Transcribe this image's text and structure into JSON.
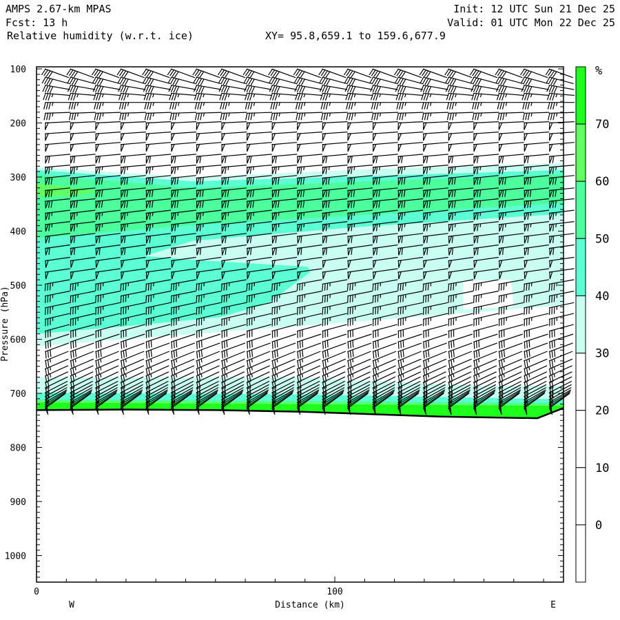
{
  "header": {
    "model": "AMPS 2.67-km MPAS",
    "fcst": "Fcst:   13 h",
    "field": "Relative humidity (w.r.t. ice)",
    "xy": "XY=  95.8,659.1 to 159.6,677.9",
    "init": "Init: 12 UTC Sun 21 Dec 25",
    "valid": "Valid: 01 UTC Mon 22 Dec 25"
  },
  "chart_data": {
    "type": "cross-section",
    "title": "Relative humidity (w.r.t. ice)",
    "xlabel": "Distance (km)",
    "ylabel": "Pressure (hPa)",
    "xlim": [
      0,
      176.7
    ],
    "ylim": [
      1049,
      97
    ],
    "x_ticks": [
      "0",
      "100"
    ],
    "x_tick_values": [
      0,
      100
    ],
    "y_ticks": [
      "100",
      "200",
      "300",
      "400",
      "500",
      "600",
      "700",
      "800",
      "900",
      "1000"
    ],
    "y_tick_values": [
      100,
      200,
      300,
      400,
      500,
      600,
      700,
      800,
      900,
      1000
    ],
    "left_end": "W",
    "right_end": "E",
    "colorbar": {
      "unit": "%",
      "labels": [
        "70",
        "60",
        "50",
        "40",
        "30",
        "20",
        "10",
        "0"
      ],
      "bins": [
        {
          "range": ">70",
          "color": "#1eff1e"
        },
        {
          "range": "60-70",
          "color": "#62ff62"
        },
        {
          "range": "50-60",
          "color": "#4dff9c"
        },
        {
          "range": "40-50",
          "color": "#5cffd4"
        },
        {
          "range": "30-40",
          "color": "#c8fff0"
        },
        {
          "range": "20-30",
          "color": "#ffffff"
        },
        {
          "range": "10-20",
          "color": "#ffffff"
        },
        {
          "range": "0-10",
          "color": "#ffffff"
        },
        {
          "range": "<0",
          "color": "#ffffff"
        }
      ]
    },
    "ground": [
      [
        0,
        731
      ],
      [
        30,
        730
      ],
      [
        60,
        731
      ],
      [
        89.4,
        734
      ],
      [
        135.6,
        743
      ],
      [
        167.9,
        746
      ],
      [
        176.7,
        727
      ]
    ],
    "fills": [
      {
        "range": "30-40",
        "color": "#c8fff0",
        "polygon": [
          [
            0,
            282
          ],
          [
            52.4,
            300
          ],
          [
            114.1,
            285
          ],
          [
            176.7,
            274
          ],
          [
            176.7,
            537
          ],
          [
            135.6,
            555
          ],
          [
            89.4,
            575
          ],
          [
            45.5,
            593
          ],
          [
            0,
            613
          ]
        ]
      },
      {
        "range": "20-30",
        "color": "#ffffff",
        "polygon": [
          [
            143,
            492
          ],
          [
            159,
            490
          ],
          [
            160,
            540
          ],
          [
            143,
            545
          ]
        ]
      },
      {
        "range": "40-50",
        "color": "#5cffd4",
        "polygon": [
          [
            0,
            287
          ],
          [
            52.4,
            308
          ],
          [
            176.7,
            287
          ],
          [
            176.7,
            368
          ],
          [
            106.2,
            393
          ],
          [
            52.4,
            418
          ],
          [
            36.3,
            446
          ],
          [
            52.4,
            453
          ],
          [
            91,
            466
          ],
          [
            91.7,
            476
          ],
          [
            77.8,
            533
          ],
          [
            61.7,
            559
          ],
          [
            31.6,
            575
          ],
          [
            0,
            590
          ]
        ]
      },
      {
        "range": "50-60",
        "color": "#4dff9c",
        "polygon": [
          [
            0,
            295
          ],
          [
            52.4,
            320
          ],
          [
            176.7,
            295
          ],
          [
            176.7,
            348
          ],
          [
            52.4,
            389
          ],
          [
            0,
            413
          ]
        ]
      },
      {
        "range": "60-70",
        "color": "#62ff62",
        "polygon": [
          [
            0,
            312
          ],
          [
            10.9,
            318
          ],
          [
            22,
            328
          ],
          [
            10.9,
            334
          ],
          [
            0,
            336
          ]
        ]
      }
    ],
    "surface_fills": [
      {
        "range": "30-40",
        "color": "#c8fff0",
        "top": [
          [
            0,
            671
          ],
          [
            89.4,
            671
          ],
          [
            110,
            677
          ],
          [
            150,
            686
          ],
          [
            176.7,
            686
          ]
        ]
      },
      {
        "range": "40-50",
        "color": "#5cffd4",
        "top": [
          [
            0,
            699
          ],
          [
            90,
            702
          ],
          [
            176.7,
            711
          ]
        ]
      },
      {
        "range": "50-60",
        "color": "#4dff9c",
        "top": [
          [
            0,
            711
          ],
          [
            90,
            714
          ],
          [
            176.7,
            718
          ]
        ]
      },
      {
        "range": "60-70",
        "color": "#62ff62",
        "top": [
          [
            0,
            714
          ],
          [
            90,
            717
          ],
          [
            176.7,
            721
          ]
        ]
      },
      {
        "range": ">70",
        "color": "#1eff1e",
        "top": [
          [
            0,
            717
          ],
          [
            90,
            720
          ],
          [
            176.7,
            723
          ]
        ]
      }
    ],
    "wind": {
      "columns_km": [
        2.8,
        11.25,
        19.7,
        28.15,
        36.6,
        45.05,
        53.5,
        61.95,
        70.4,
        78.85,
        87.3,
        95.75,
        104.2,
        112.65,
        121.1,
        129.55,
        138,
        146.45,
        154.9,
        163.35,
        171.8
      ],
      "levels_hPa": [
        100,
        115,
        130,
        145,
        162,
        182,
        200,
        220,
        240,
        262,
        282,
        302,
        325,
        345,
        367,
        388,
        410,
        432,
        455,
        476,
        498,
        520,
        542,
        563,
        585,
        605,
        623,
        640,
        655,
        668,
        680,
        690,
        699,
        706,
        712,
        717,
        721,
        725,
        728
      ],
      "speed_kt": [
        40,
        40,
        40,
        35,
        35,
        35,
        50,
        50,
        50,
        60,
        65,
        70,
        70,
        70,
        65,
        65,
        60,
        60,
        50,
        50,
        35,
        35,
        35,
        35,
        30,
        30,
        30,
        25,
        25,
        25,
        20,
        20,
        20,
        15,
        15,
        15,
        10,
        10,
        10
      ],
      "staff_angle_deg": [
        -20,
        -15,
        -10,
        -5,
        0,
        2,
        3,
        4,
        5,
        5,
        5,
        6,
        6,
        6,
        7,
        7,
        7,
        8,
        8,
        8,
        10,
        11,
        12,
        13,
        15,
        18,
        20,
        22,
        23,
        24,
        25,
        26,
        27,
        28,
        29,
        30,
        32,
        34,
        36
      ]
    }
  }
}
